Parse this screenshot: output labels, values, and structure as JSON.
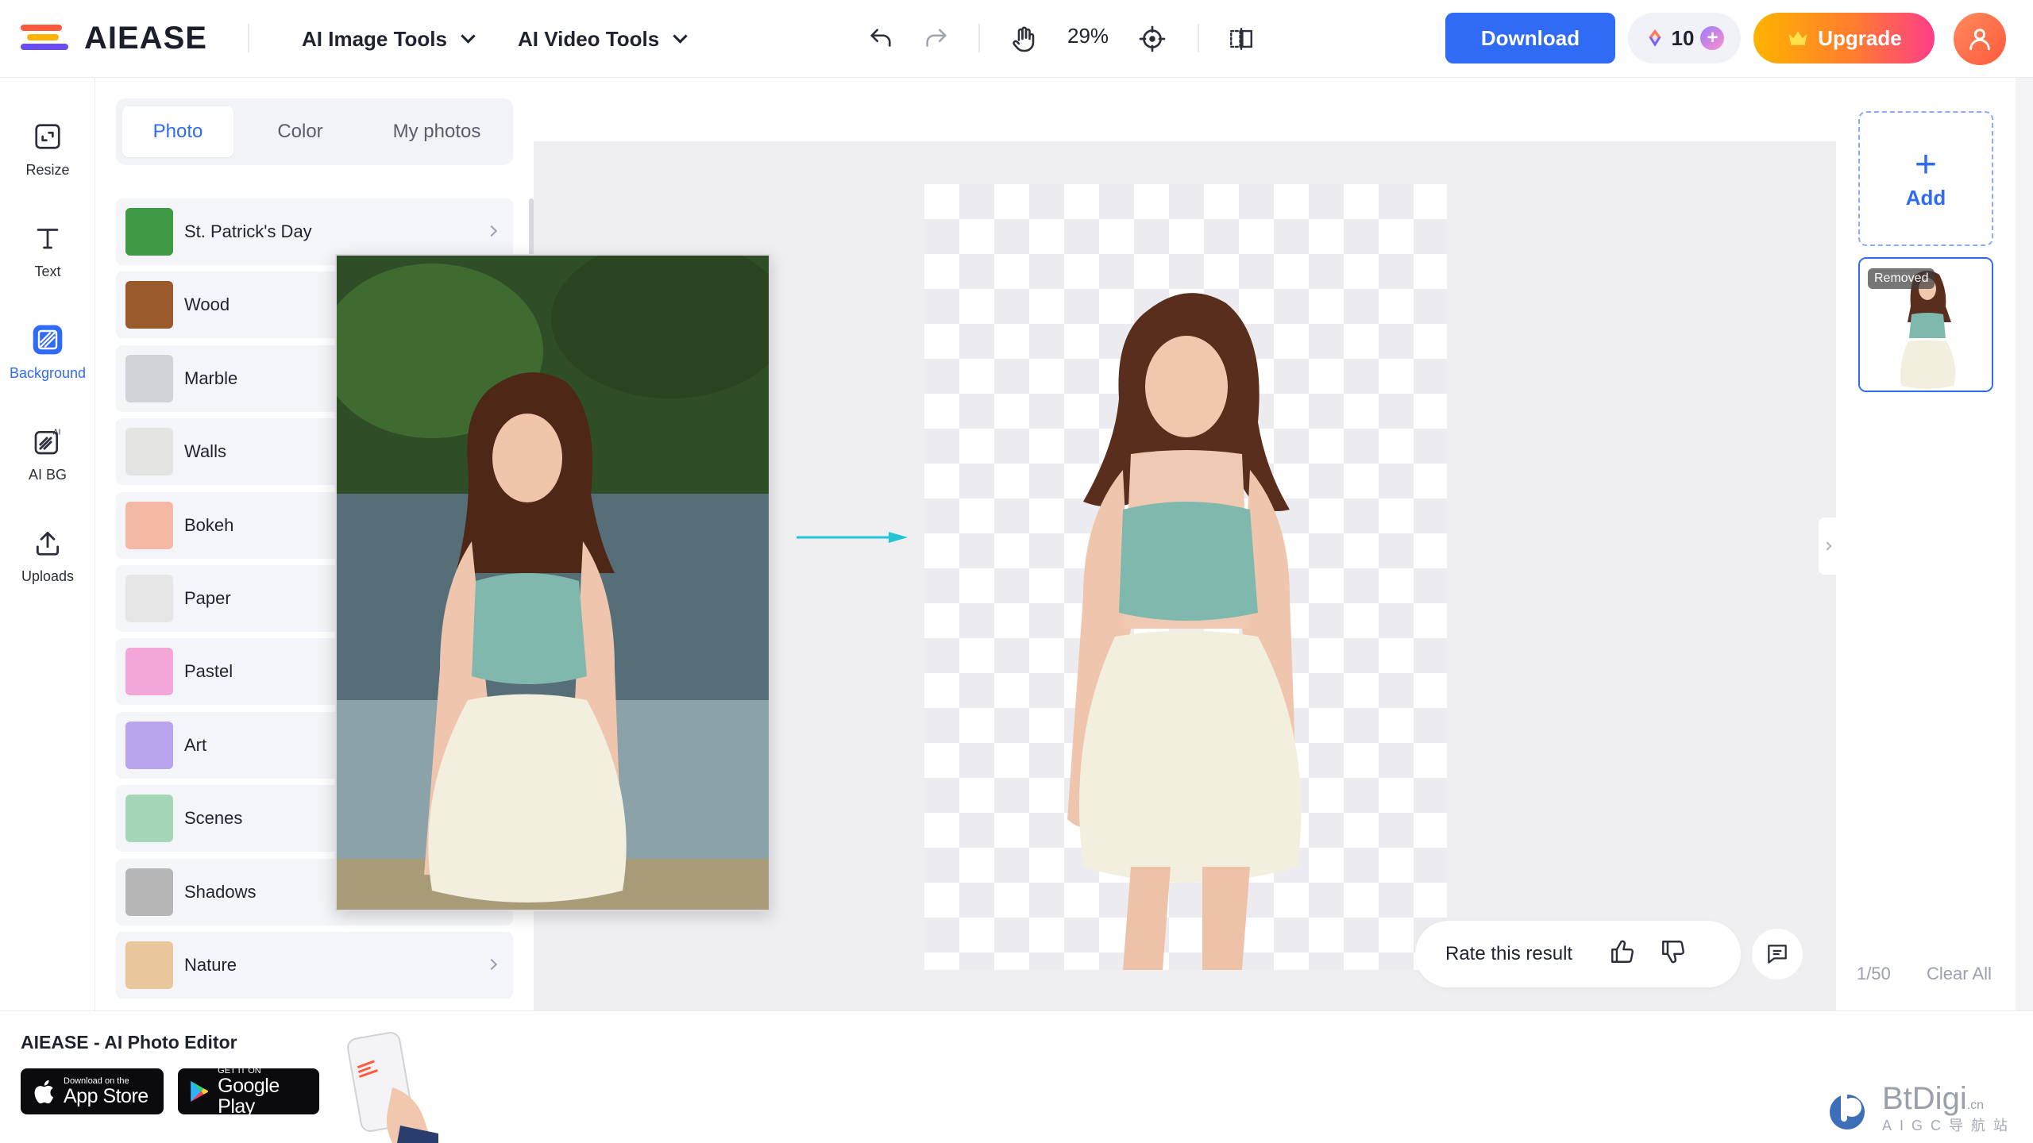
{
  "app": {
    "logo_text": "AIEASE",
    "brand_colors": {
      "primary": "#2f6bf5",
      "upgrade_start": "#ffb300",
      "upgrade_end": "#ff3d8a"
    }
  },
  "header": {
    "menus": [
      {
        "label": "AI Image Tools",
        "icon": "chevron-down-icon"
      },
      {
        "label": "AI Video Tools",
        "icon": "chevron-down-icon"
      }
    ],
    "tools": [
      "undo-icon",
      "redo-icon",
      "hand-icon",
      "crosshair-icon",
      "compare-icon"
    ],
    "zoom_level": "29%",
    "download_label": "Download",
    "credits_count": "10",
    "upgrade_label": "Upgrade"
  },
  "sidebar": {
    "items": [
      {
        "label": "Resize",
        "icon": "resize-icon",
        "active": false
      },
      {
        "label": "Text",
        "icon": "text-icon",
        "active": false
      },
      {
        "label": "Background",
        "icon": "background-icon",
        "active": true
      },
      {
        "label": "AI BG",
        "icon": "ai-bg-icon",
        "active": false
      },
      {
        "label": "Uploads",
        "icon": "upload-icon",
        "active": false
      }
    ]
  },
  "panel": {
    "tabs": [
      {
        "label": "Photo",
        "active": true
      },
      {
        "label": "Color",
        "active": false
      },
      {
        "label": "My photos",
        "active": false
      }
    ],
    "categories": [
      {
        "label": "St. Patrick's Day",
        "color": "#3f9a46"
      },
      {
        "label": "Wood",
        "color": "#9a5a2c"
      },
      {
        "label": "Marble",
        "color": "#cfd2d6"
      },
      {
        "label": "Walls",
        "color": "#e4e4e2"
      },
      {
        "label": "Bokeh",
        "color": "#f4b9a4"
      },
      {
        "label": "Paper",
        "color": "#e6e6e6"
      },
      {
        "label": "Pastel",
        "color": "#f3a6d8"
      },
      {
        "label": "Art",
        "color": "#b9a4ee"
      },
      {
        "label": "Scenes",
        "color": "#a6d6b8"
      },
      {
        "label": "Shadows",
        "color": "#b6b6b6"
      },
      {
        "label": "Nature",
        "color": "#e9c79a"
      }
    ]
  },
  "canvas": {
    "rate_label": "Rate this result"
  },
  "right_panel": {
    "add_label": "Add",
    "thumb_badge": "Removed",
    "counter": "1/50",
    "clear_label": "Clear All"
  },
  "footer": {
    "title": "AIEASE - AI Photo Editor",
    "app_store_small": "Download on the",
    "app_store_big": "App Store",
    "google_small": "GET IT ON",
    "google_big": "Google Play",
    "watermark_big": "BtDigi",
    "watermark_sup": ".cn",
    "watermark_small": "AIGC导航站"
  }
}
